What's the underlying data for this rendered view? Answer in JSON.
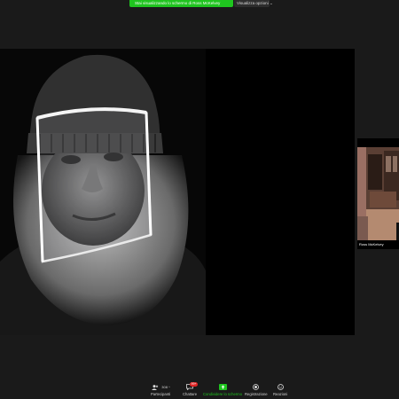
{
  "banner": {
    "text": "Stai visualizzando lo schermo di Ross McKelvey",
    "options": "Visualizza opzioni"
  },
  "thumbnail": {
    "name": "Ross McKelvey"
  },
  "toolbar": {
    "participants": {
      "label": "Partecipanti",
      "count": "308"
    },
    "chat": {
      "label": "Chattare",
      "badge": "99+"
    },
    "share": {
      "label": "Condividere lo schermo"
    },
    "record": {
      "label": "Registrazione"
    },
    "reactions": {
      "label": "Reazioni"
    }
  }
}
